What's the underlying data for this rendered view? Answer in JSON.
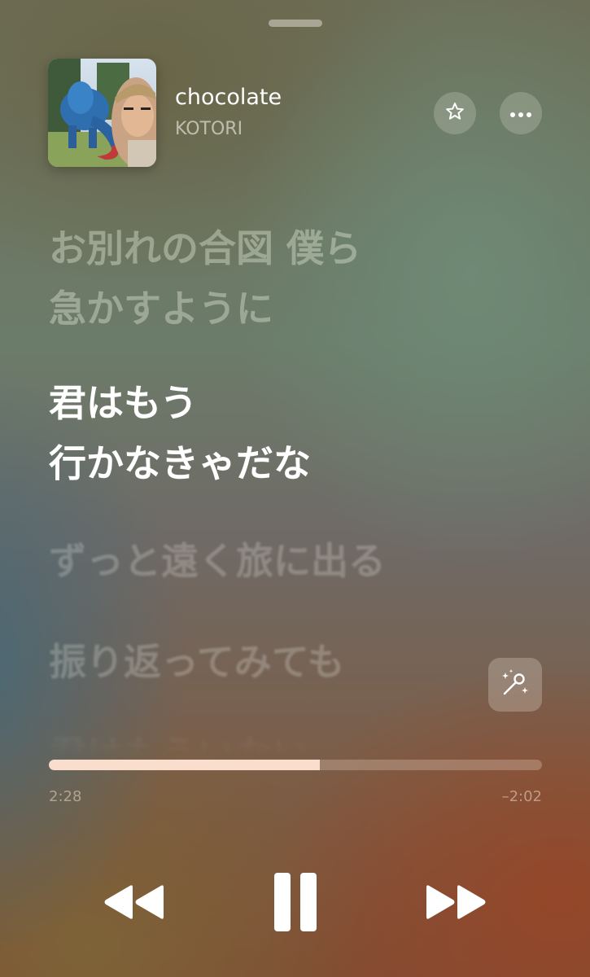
{
  "player": {
    "grabber": "sheet-grabber",
    "track": {
      "title": "chocolate",
      "artist": "KOTORI"
    },
    "actions": {
      "favorite_icon": "star-icon",
      "more_icon": "ellipsis-icon"
    },
    "lyrics": {
      "lines": [
        {
          "text": "お別れの合図 僕ら",
          "state": "past"
        },
        {
          "text": "急かすように",
          "state": "past"
        },
        {
          "text": "君はもう",
          "state": "current"
        },
        {
          "text": "行かなきゃだな",
          "state": "current"
        },
        {
          "text": "ずっと遠く旅に出る",
          "state": "upcoming"
        },
        {
          "text": "振り返ってみても",
          "state": "upcoming"
        },
        {
          "text": "君はもういない",
          "state": "upcoming"
        }
      ],
      "karaoke_icon": "sing-microphone-icon"
    },
    "progress": {
      "elapsed": "2:28",
      "remaining": "–2:02",
      "fraction": 0.55
    },
    "controls": {
      "previous_icon": "rewind-icon",
      "play_pause_icon": "pause-icon",
      "next_icon": "fast-forward-icon"
    },
    "colors": {
      "progress_fill": "#fadecd",
      "lyric_current": "#ffffff"
    }
  }
}
